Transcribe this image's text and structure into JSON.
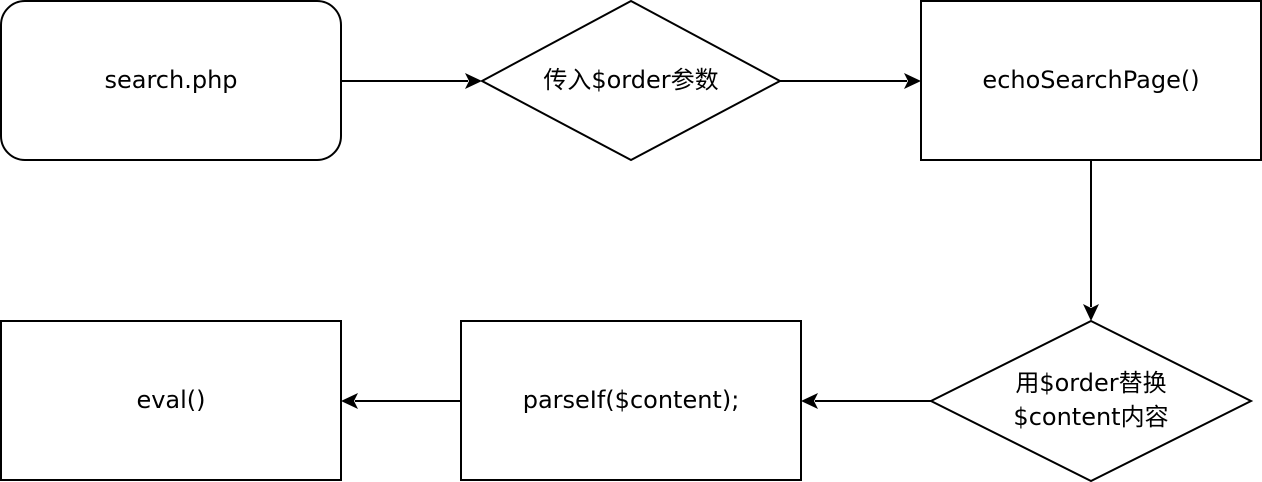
{
  "nodes": {
    "start": {
      "label": "search.php"
    },
    "param": {
      "label": "传入$order参数"
    },
    "echo": {
      "label": "echoSearchPage()"
    },
    "replace": {
      "line1": "用$order替换",
      "line2": "$content内容"
    },
    "parse": {
      "label": "parseIf($content);"
    },
    "eval": {
      "label": "eval()"
    }
  }
}
